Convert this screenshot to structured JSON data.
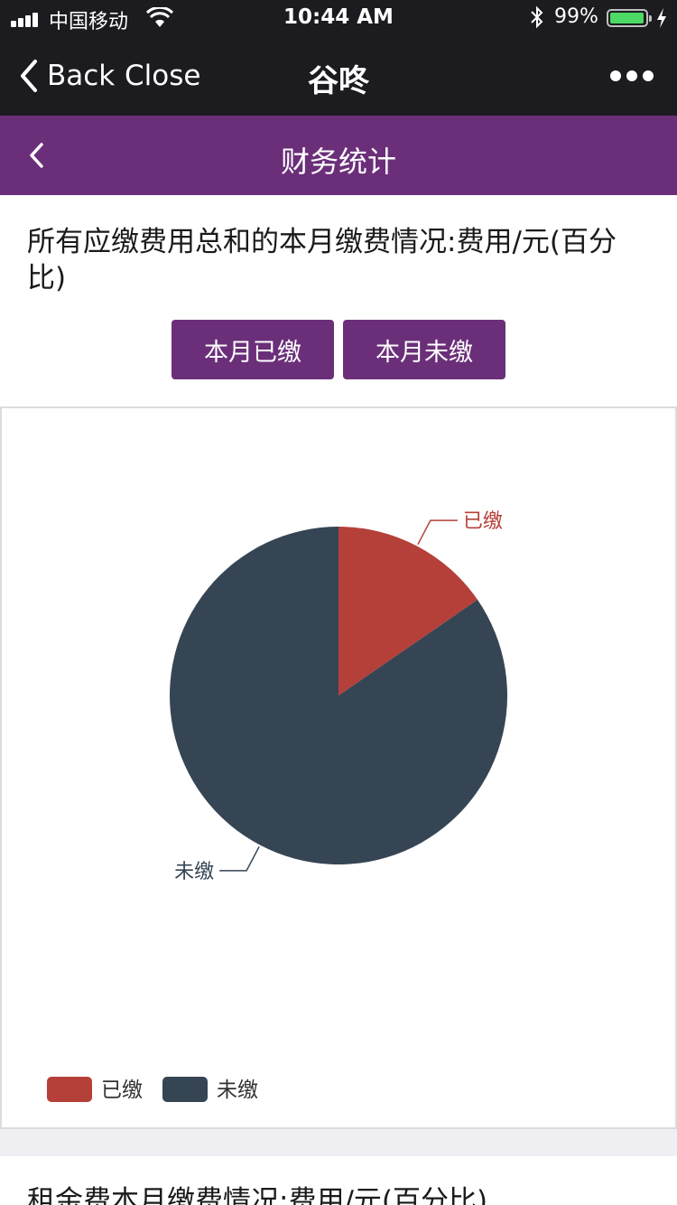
{
  "status_bar": {
    "carrier": "中国移动",
    "time": "10:44 AM",
    "battery": "99%"
  },
  "nav": {
    "back_label": "Back",
    "close_label": "Close",
    "title": "谷咚"
  },
  "header": {
    "title": "财务统计"
  },
  "section1": {
    "title": "所有应缴费用总和的本月缴费情况:费用/元(百分比)",
    "buttons": [
      "本月已缴",
      "本月未缴"
    ]
  },
  "chart_data": {
    "type": "pie",
    "slices": [
      {
        "name": "已缴",
        "value": 15.4,
        "color": "#b5403a"
      },
      {
        "name": "未缴",
        "value": 84.6,
        "color": "#354554"
      }
    ],
    "legend": [
      "已缴",
      "未缴"
    ],
    "legend_position": "bottom-left"
  },
  "section2": {
    "title": "租金费本月缴费情况:费用/元(百分比)"
  },
  "colors": {
    "bar_dark": "#1c1b1f",
    "accent": "#6b2f7a"
  }
}
